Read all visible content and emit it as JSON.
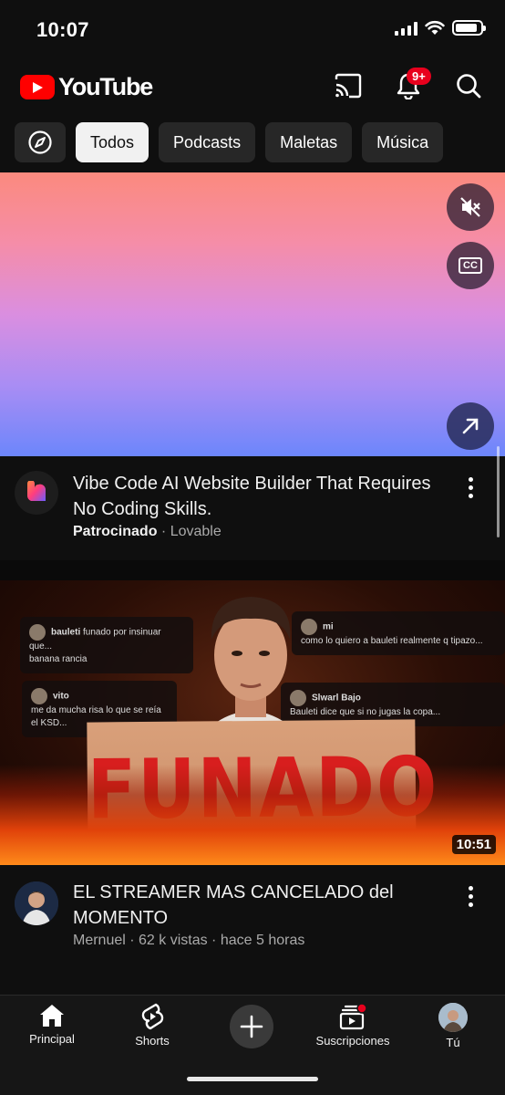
{
  "status_bar": {
    "time": "10:07"
  },
  "header": {
    "app_name": "YouTube",
    "notifications_badge": "9+",
    "brand_color": "#ff0000"
  },
  "chips": [
    {
      "label": "Todos",
      "active": true
    },
    {
      "label": "Podcasts",
      "active": false
    },
    {
      "label": "Maletas",
      "active": false
    },
    {
      "label": "Música",
      "active": false
    }
  ],
  "ad": {
    "title": "Vibe Code AI Website Builder That Requires No Coding Skills.",
    "sponsored_label": "Patrocinado",
    "separator": "·",
    "advertiser": "Lovable",
    "controls": {
      "mute_icon": "speaker-muted-icon",
      "captions_label": "CC",
      "open_icon": "arrow-up-right-icon"
    }
  },
  "video": {
    "thumbnail_sign_text": "FUNADO",
    "duration": "10:51",
    "title": "EL STREAMER MAS CANCELADO del MOMENTO",
    "meta": "Mernuel · 62 k vistas · hace 5 horas"
  },
  "bottom_nav": {
    "home": "Principal",
    "shorts": "Shorts",
    "subscriptions": "Suscripciones",
    "you": "Tú"
  }
}
